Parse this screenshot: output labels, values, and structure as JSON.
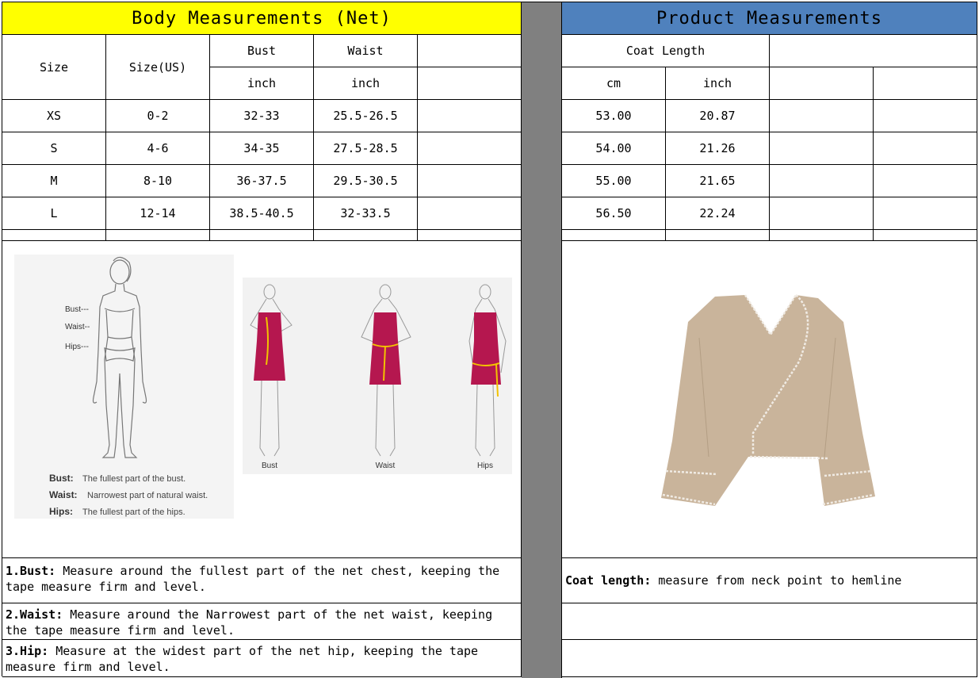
{
  "body_table": {
    "title": "Body Measurements (Net)",
    "col_size": "Size",
    "col_size_us": "Size(US)",
    "col_bust": "Bust",
    "col_waist": "Waist",
    "unit_bust": "inch",
    "unit_waist": "inch",
    "rows": [
      {
        "size": "XS",
        "size_us": "0-2",
        "bust": "32-33",
        "waist": "25.5-26.5"
      },
      {
        "size": "S",
        "size_us": "4-6",
        "bust": "34-35",
        "waist": "27.5-28.5"
      },
      {
        "size": "M",
        "size_us": "8-10",
        "bust": "36-37.5",
        "waist": "29.5-30.5"
      },
      {
        "size": "L",
        "size_us": "12-14",
        "bust": "38.5-40.5",
        "waist": "32-33.5"
      }
    ]
  },
  "product_table": {
    "title": "Product Measurements",
    "col_coat_length": "Coat Length",
    "unit_cm": "cm",
    "unit_inch": "inch",
    "rows": [
      {
        "cm": "53.00",
        "inch": "20.87"
      },
      {
        "cm": "54.00",
        "inch": "21.26"
      },
      {
        "cm": "55.00",
        "inch": "21.65"
      },
      {
        "cm": "56.50",
        "inch": "22.24"
      }
    ]
  },
  "body_diagram": {
    "label_bust": "Bust---",
    "label_waist": "Waist--",
    "label_hips": "Hips---",
    "legend": [
      {
        "term": "Bust:",
        "text": "The fullest part of the bust."
      },
      {
        "term": "Waist:",
        "text": "Narrowest part of natural waist."
      },
      {
        "term": "Hips:",
        "text": "The fullest part of the hips."
      }
    ],
    "figure_captions": [
      "Bust",
      "Waist",
      "Hips"
    ]
  },
  "notes": {
    "bust_term": "1.Bust:",
    "bust_text": " Measure around the fullest part of the net chest, keeping the tape  measure firm and level.",
    "waist_term": "2.Waist:",
    "waist_text": " Measure around the Narrowest part of the net waist, keeping the tape  measure firm and level.",
    "hip_term": "3.Hip:",
    "hip_text": " Measure at the widest part of the net hip, keeping the tape measure firm and level.",
    "coat_term": "Coat length:",
    "coat_text": " measure from neck point to hemline"
  },
  "colors": {
    "body_header": "#ffff00",
    "product_header": "#4f81bd",
    "separator": "#808080",
    "dress": "#b5174f",
    "tape": "#f2c200",
    "coat": "#c9b49b"
  }
}
